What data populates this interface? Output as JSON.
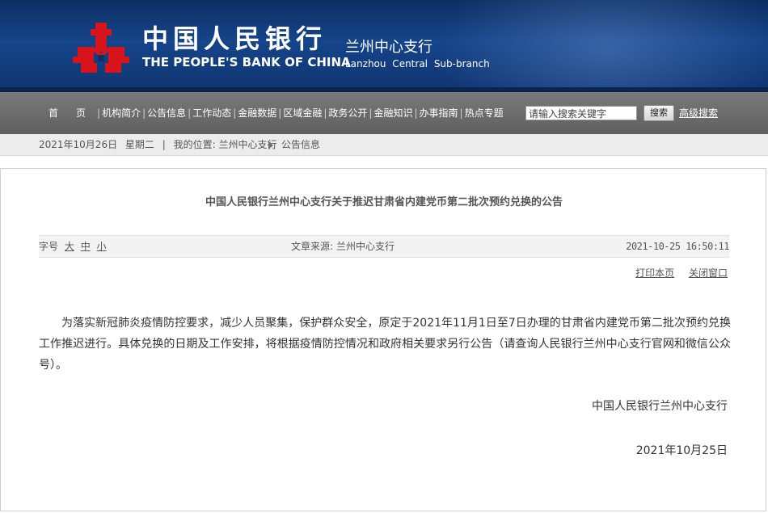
{
  "header": {
    "bank_cn": "中国人民银行",
    "bank_en": "THE PEOPLE'S BANK OF CHINA",
    "branch_cn": "兰州中心支行",
    "branch_en": "Lanzhou Central Sub-branch",
    "logo_icon": "pboc-logo-icon",
    "brand_color": "#0d2f63",
    "logo_color": "#d7131b"
  },
  "nav": {
    "items": [
      "首页",
      "机构简介",
      "公告信息",
      "工作动态",
      "金融数据",
      "区域金融",
      "政务公开",
      "金融知识",
      "办事指南",
      "热点专题"
    ],
    "search_placeholder": "请输入搜索关键字",
    "search_button": "搜索",
    "advanced_search": "高级搜索"
  },
  "breadcrumb": {
    "date": "2021年10月26日",
    "weekday": "星期二",
    "separator": "|",
    "location_prefix": "我的位置:",
    "location_branch": "兰州中心支行",
    "current": "公告信息"
  },
  "article": {
    "title": "中国人民银行兰州中心支行关于推迟甘肃省内建党币第二批次预约兑换的公告",
    "font_size_label": "字号",
    "font_sizes": [
      "大",
      "中",
      "小"
    ],
    "source_label": "文章来源:",
    "source": "兰州中心支行",
    "published": "2021-10-25 16:50:11",
    "print": "打印本页",
    "close": "关闭窗口",
    "body": "为落实新冠肺炎疫情防控要求，减少人员聚集，保护群众安全，原定于2021年11月1日至7日办理的甘肃省内建党币第二批次预约兑换工作推迟进行。具体兑换的日期及工作安排，将根据疫情防控情况和政府相关要求另行公告（请查询人民银行兰州中心支行官网和微信公众号）。",
    "signature": "中国人民银行兰州中心支行",
    "sign_date": "2021年10月25日"
  }
}
